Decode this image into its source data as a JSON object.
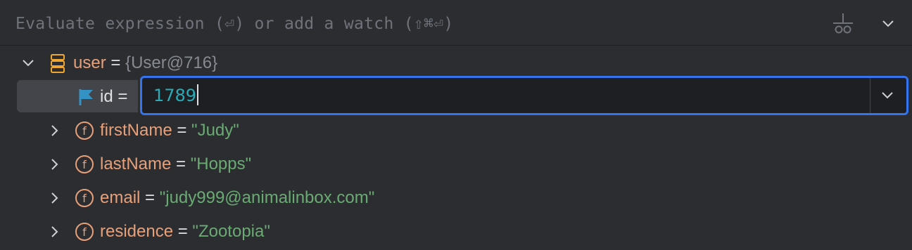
{
  "evaluate": {
    "placeholder": "Evaluate expression (⏎) or add a watch (⇧⌘⏎)"
  },
  "toolbar": {
    "icons": [
      "add-watch-icon",
      "chevron-down-icon"
    ]
  },
  "tree": {
    "root": {
      "name": "user",
      "eq": " = ",
      "value": "{User@716}",
      "icon": "object-stack-icon",
      "expanded": true
    },
    "editing": {
      "name": "id",
      "eq": " = ",
      "value": "1789",
      "icon": "flag-icon"
    },
    "fields": [
      {
        "name": "firstName",
        "eq": " = ",
        "value": "\"Judy\"",
        "icon": "field-f-icon"
      },
      {
        "name": "lastName",
        "eq": " = ",
        "value": "\"Hopps\"",
        "icon": "field-f-icon"
      },
      {
        "name": "email",
        "eq": " = ",
        "value": "\"judy999@animalinbox.com\"",
        "icon": "field-f-icon"
      },
      {
        "name": "residence",
        "eq": " = ",
        "value": "\"Zootopia\"",
        "icon": "field-f-icon"
      }
    ]
  },
  "colors": {
    "background": "#2b2d30",
    "field_name": "#e8a07a",
    "string_value": "#6aab73",
    "number_value": "#2aacb8",
    "focus_border": "#3574f0",
    "muted": "#868a91"
  }
}
